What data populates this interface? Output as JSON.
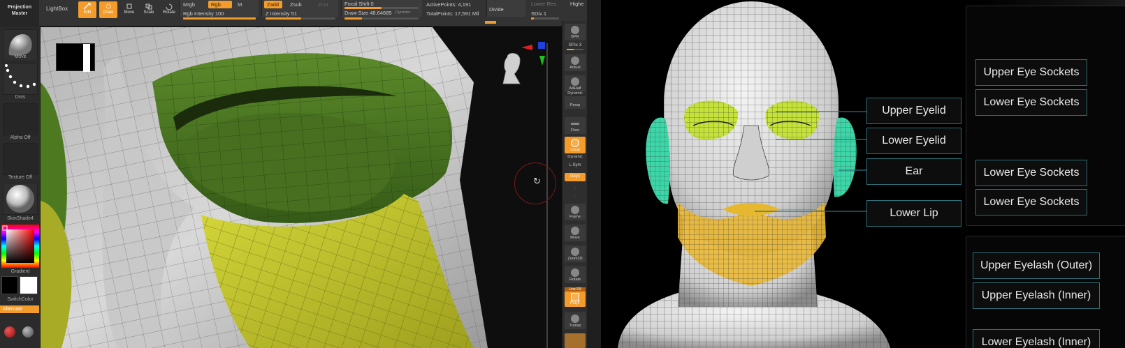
{
  "toolbar": {
    "project_line1": "Projection",
    "project_line2": "Master",
    "lightbox": "LightBox",
    "edit": "Edit",
    "draw": "Draw",
    "move": "Move",
    "scale": "Scale",
    "rotate": "Rotate",
    "mrgb": "Mrgb",
    "rgb": "Rgb",
    "m": "M",
    "rgb_intensity": "Rgb Intensity 100",
    "zadd": "Zadd",
    "zsub": "Zsub",
    "zcut": "Zcut",
    "z_intensity": "Z Intensity 51",
    "focal_shift": "Focal Shift 0",
    "draw_size": "Draw Size 48.64685",
    "dynamic": "Dynamic",
    "active_points": "ActivePoints: 4,191",
    "total_points": "TotalPoints: 17,591 Mil",
    "divide": "Divide",
    "lower_res": "Lower Res",
    "higher": "Highe",
    "sdiv": "SDiv 1"
  },
  "left_tray": {
    "move_brush": "Move",
    "dots": "Dots",
    "alpha_off": "Alpha Off",
    "texture_off": "Texture Off",
    "material": "SkinShade4",
    "gradient": "Gradient",
    "switch_color": "SwitchColor",
    "alternate": "Alternate"
  },
  "right_shelf": {
    "bpr": "BPR",
    "spix": "SPix 3",
    "actual": "Actual",
    "aahalf": "AAHalf",
    "dynamic": "Dynamic",
    "persp": "Persp",
    "floor": "Floor",
    "local": "Local",
    "dynamic2": "Dynamic",
    "lsym": "L.Sym",
    "xyz": "Gxyz",
    "frame": "Frame",
    "move": "Move",
    "zoom3d": "Zoom3D",
    "rotate": "Rotate",
    "line_fill": "Line Fill",
    "polyf": "PolyF",
    "transp": "Transp"
  },
  "colors": {
    "accent": "#f39c2b",
    "green_mesh": "#4e7a22",
    "yellow_mesh": "#c2c42a",
    "label_border": "#2f6f7a"
  },
  "reference": {
    "center_labels": [
      "Upper Eyelid",
      "Lower Eyelid",
      "Ear",
      "Lower Lip"
    ],
    "right_group1": [
      "Upper Eye Sockets",
      "Lower Eye Sockets",
      "Lower Eye Sockets",
      "Lower Eye Sockets"
    ],
    "right_group2": [
      "Upper Eyelash (Outer)",
      "Upper Eyelash (Inner)",
      "Lower Eyelash (Inner)"
    ]
  }
}
